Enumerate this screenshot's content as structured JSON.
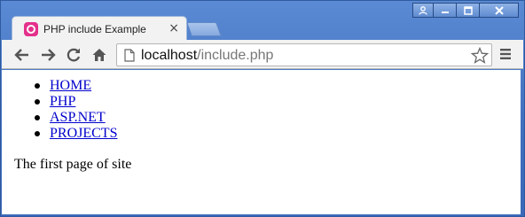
{
  "window": {
    "controls": [
      "user-icon",
      "minimize-icon",
      "maximize-icon",
      "close-icon"
    ]
  },
  "tab": {
    "title": "PHP include Example",
    "close_symbol": "×",
    "favicon": "wampserver-icon",
    "favicon_color": "#e4308b"
  },
  "toolbar": {
    "icons": [
      "back-arrow-icon",
      "forward-arrow-icon",
      "reload-icon",
      "home-icon",
      "page-icon",
      "star-icon",
      "menu-icon"
    ]
  },
  "address_bar": {
    "host": "localhost",
    "path": "/include.php"
  },
  "page": {
    "nav_items": [
      {
        "label": "HOME"
      },
      {
        "label": "PHP"
      },
      {
        "label": "ASP.NET"
      },
      {
        "label": "PROJECTS"
      }
    ],
    "body_text": "The first page of site"
  },
  "colors": {
    "titlebar": "#4a7ac6",
    "link": "#0000cc"
  }
}
